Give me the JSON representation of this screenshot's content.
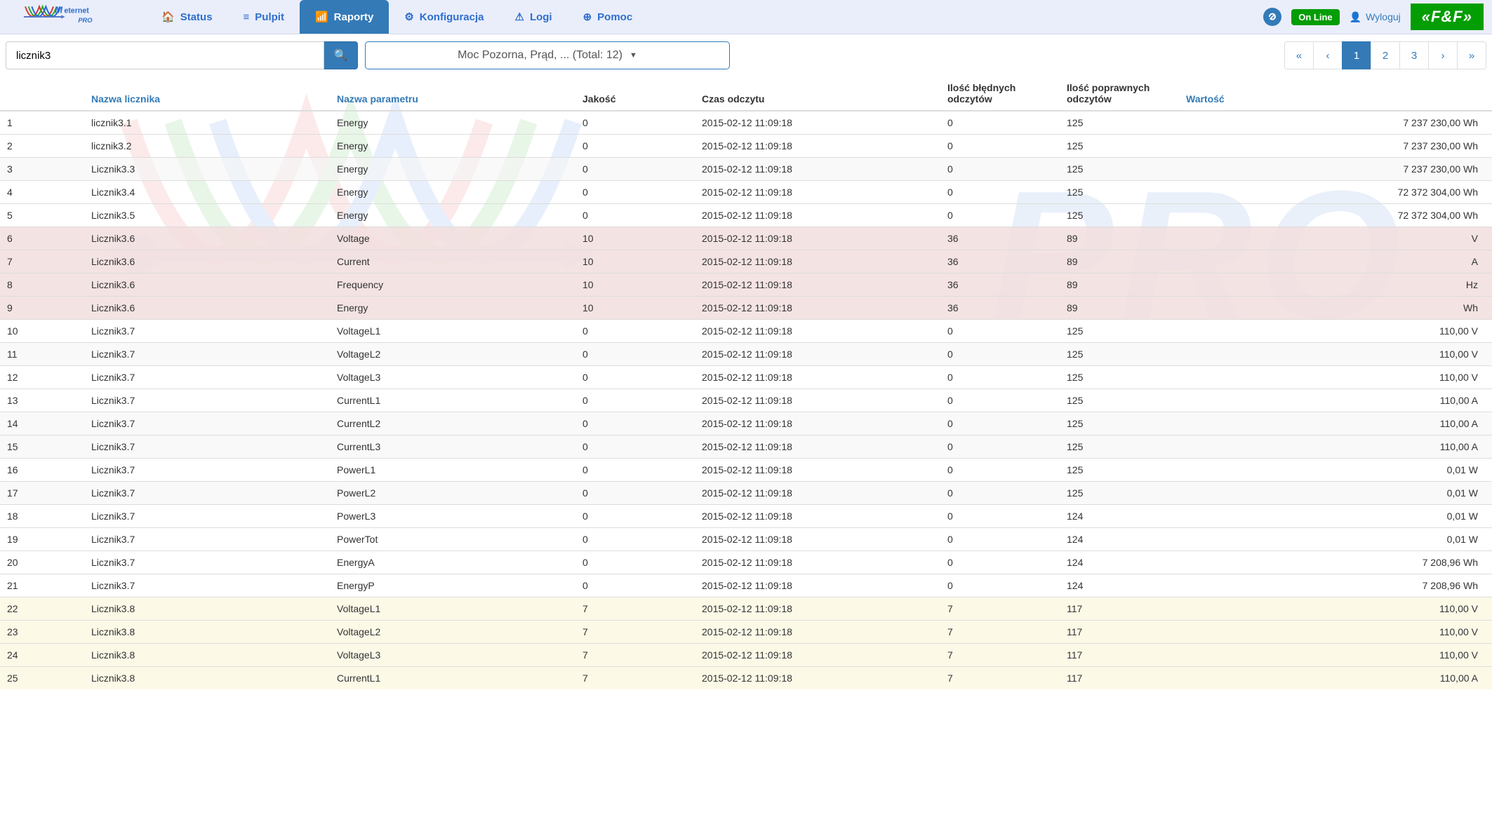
{
  "brand": {
    "name": "Meternet",
    "sub": "PRO"
  },
  "nav": {
    "items": [
      {
        "label": "Status",
        "icon": "home",
        "active": false
      },
      {
        "label": "Pulpit",
        "icon": "list",
        "active": false
      },
      {
        "label": "Raporty",
        "icon": "chart",
        "active": true
      },
      {
        "label": "Konfiguracja",
        "icon": "gear",
        "active": false
      },
      {
        "label": "Logi",
        "icon": "warning",
        "active": false
      },
      {
        "label": "Pomoc",
        "icon": "help",
        "active": false
      }
    ]
  },
  "header_right": {
    "status_label": "On Line",
    "logout_label": "Wyloguj",
    "brand_right": "«F&F»"
  },
  "toolbar": {
    "search_value": "licznik3",
    "filter_label": "Moc Pozorna,   Prąd, ... (Total: 12)"
  },
  "pagination": {
    "first": "«",
    "prev": "‹",
    "pages": [
      "1",
      "2",
      "3"
    ],
    "active_page": "1",
    "next": "›",
    "last": "»"
  },
  "columns": {
    "idx": "",
    "name": "Nazwa licznika",
    "param": "Nazwa parametru",
    "quality": "Jakość",
    "time": "Czas odczytu",
    "bad": "Ilość błędnych odczytów",
    "good": "Ilość poprawnych odczytów",
    "value": "Wartość"
  },
  "rows": [
    {
      "idx": "1",
      "name": "licznik3.1",
      "param": "Energy",
      "quality": "0",
      "time": "2015-02-12 11:09:18",
      "bad": "0",
      "good": "125",
      "value": "7 237 230,00 Wh",
      "cls": "row-odd"
    },
    {
      "idx": "2",
      "name": "licznik3.2",
      "param": "Energy",
      "quality": "0",
      "time": "2015-02-12 11:09:18",
      "bad": "0",
      "good": "125",
      "value": "7 237 230,00 Wh",
      "cls": "row-odd"
    },
    {
      "idx": "3",
      "name": "Licznik3.3",
      "param": "Energy",
      "quality": "0",
      "time": "2015-02-12 11:09:18",
      "bad": "0",
      "good": "125",
      "value": "7 237 230,00 Wh",
      "cls": "row-even"
    },
    {
      "idx": "4",
      "name": "Licznik3.4",
      "param": "Energy",
      "quality": "0",
      "time": "2015-02-12 11:09:18",
      "bad": "0",
      "good": "125",
      "value": "72 372 304,00 Wh",
      "cls": "row-odd"
    },
    {
      "idx": "5",
      "name": "Licznik3.5",
      "param": "Energy",
      "quality": "0",
      "time": "2015-02-12 11:09:18",
      "bad": "0",
      "good": "125",
      "value": "72 372 304,00 Wh",
      "cls": "row-odd"
    },
    {
      "idx": "6",
      "name": "Licznik3.6",
      "param": "Voltage",
      "quality": "10",
      "time": "2015-02-12 11:09:18",
      "bad": "36",
      "good": "89",
      "value": "V",
      "cls": "row-red"
    },
    {
      "idx": "7",
      "name": "Licznik3.6",
      "param": "Current",
      "quality": "10",
      "time": "2015-02-12 11:09:18",
      "bad": "36",
      "good": "89",
      "value": "A",
      "cls": "row-red"
    },
    {
      "idx": "8",
      "name": "Licznik3.6",
      "param": "Frequency",
      "quality": "10",
      "time": "2015-02-12 11:09:18",
      "bad": "36",
      "good": "89",
      "value": "Hz",
      "cls": "row-red"
    },
    {
      "idx": "9",
      "name": "Licznik3.6",
      "param": "Energy",
      "quality": "10",
      "time": "2015-02-12 11:09:18",
      "bad": "36",
      "good": "89",
      "value": "Wh",
      "cls": "row-red"
    },
    {
      "idx": "10",
      "name": "Licznik3.7",
      "param": "VoltageL1",
      "quality": "0",
      "time": "2015-02-12 11:09:18",
      "bad": "0",
      "good": "125",
      "value": "110,00 V",
      "cls": "row-odd"
    },
    {
      "idx": "11",
      "name": "Licznik3.7",
      "param": "VoltageL2",
      "quality": "0",
      "time": "2015-02-12 11:09:18",
      "bad": "0",
      "good": "125",
      "value": "110,00 V",
      "cls": "row-even"
    },
    {
      "idx": "12",
      "name": "Licznik3.7",
      "param": "VoltageL3",
      "quality": "0",
      "time": "2015-02-12 11:09:18",
      "bad": "0",
      "good": "125",
      "value": "110,00 V",
      "cls": "row-odd"
    },
    {
      "idx": "13",
      "name": "Licznik3.7",
      "param": "CurrentL1",
      "quality": "0",
      "time": "2015-02-12 11:09:18",
      "bad": "0",
      "good": "125",
      "value": "110,00 A",
      "cls": "row-odd"
    },
    {
      "idx": "14",
      "name": "Licznik3.7",
      "param": "CurrentL2",
      "quality": "0",
      "time": "2015-02-12 11:09:18",
      "bad": "0",
      "good": "125",
      "value": "110,00 A",
      "cls": "row-even"
    },
    {
      "idx": "15",
      "name": "Licznik3.7",
      "param": "CurrentL3",
      "quality": "0",
      "time": "2015-02-12 11:09:18",
      "bad": "0",
      "good": "125",
      "value": "110,00 A",
      "cls": "row-even"
    },
    {
      "idx": "16",
      "name": "Licznik3.7",
      "param": "PowerL1",
      "quality": "0",
      "time": "2015-02-12 11:09:18",
      "bad": "0",
      "good": "125",
      "value": "0,01 W",
      "cls": "row-odd"
    },
    {
      "idx": "17",
      "name": "Licznik3.7",
      "param": "PowerL2",
      "quality": "0",
      "time": "2015-02-12 11:09:18",
      "bad": "0",
      "good": "125",
      "value": "0,01 W",
      "cls": "row-even"
    },
    {
      "idx": "18",
      "name": "Licznik3.7",
      "param": "PowerL3",
      "quality": "0",
      "time": "2015-02-12 11:09:18",
      "bad": "0",
      "good": "124",
      "value": "0,01 W",
      "cls": "row-odd"
    },
    {
      "idx": "19",
      "name": "Licznik3.7",
      "param": "PowerTot",
      "quality": "0",
      "time": "2015-02-12 11:09:18",
      "bad": "0",
      "good": "124",
      "value": "0,01 W",
      "cls": "row-odd"
    },
    {
      "idx": "20",
      "name": "Licznik3.7",
      "param": "EnergyA",
      "quality": "0",
      "time": "2015-02-12 11:09:18",
      "bad": "0",
      "good": "124",
      "value": "7 208,96 Wh",
      "cls": "row-odd"
    },
    {
      "idx": "21",
      "name": "Licznik3.7",
      "param": "EnergyP",
      "quality": "0",
      "time": "2015-02-12 11:09:18",
      "bad": "0",
      "good": "124",
      "value": "7 208,96 Wh",
      "cls": "row-odd"
    },
    {
      "idx": "22",
      "name": "Licznik3.8",
      "param": "VoltageL1",
      "quality": "7",
      "time": "2015-02-12 11:09:18",
      "bad": "7",
      "good": "117",
      "value": "110,00 V",
      "cls": "row-yellow"
    },
    {
      "idx": "23",
      "name": "Licznik3.8",
      "param": "VoltageL2",
      "quality": "7",
      "time": "2015-02-12 11:09:18",
      "bad": "7",
      "good": "117",
      "value": "110,00 V",
      "cls": "row-yellow"
    },
    {
      "idx": "24",
      "name": "Licznik3.8",
      "param": "VoltageL3",
      "quality": "7",
      "time": "2015-02-12 11:09:18",
      "bad": "7",
      "good": "117",
      "value": "110,00 V",
      "cls": "row-yellow"
    },
    {
      "idx": "25",
      "name": "Licznik3.8",
      "param": "CurrentL1",
      "quality": "7",
      "time": "2015-02-12 11:09:18",
      "bad": "7",
      "good": "117",
      "value": "110,00 A",
      "cls": "row-yellow"
    }
  ]
}
